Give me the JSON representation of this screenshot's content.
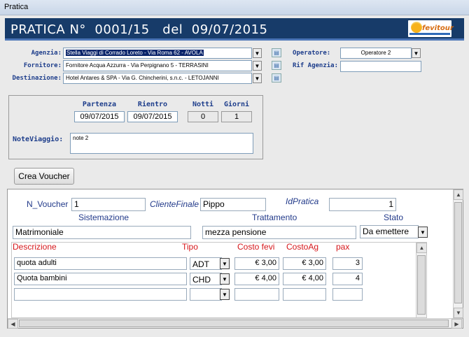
{
  "window": {
    "title": "Pratica"
  },
  "header": {
    "title": "PRATICA N°  0001/15   del  09/07/2015",
    "logo_text": "fevitour"
  },
  "top_fields": {
    "agenzia": {
      "label": "Agenzia:",
      "value": "Stella Viaggi di Corrado Loreto  -  Via Roma 62  -  AVOLA"
    },
    "fornitore": {
      "label": "Fornitore:",
      "value": "Fornitore Acqua Azzurra  -  Via Perpignano 5  -  TERRASINI"
    },
    "destinazione": {
      "label": "Destinazione:",
      "value": "Hotel Antares & SPA  -  Via G. Chincherini, s.n.c.  -  LETOJANNI"
    },
    "operatore": {
      "label": "Operatore:",
      "value": "Operatore 2"
    },
    "rif_agenzia": {
      "label": "Rif Agenzia:",
      "value": ""
    }
  },
  "travel": {
    "partenza_label": "Partenza",
    "partenza": "09/07/2015",
    "rientro_label": "Rientro",
    "rientro": "09/07/2015",
    "notti_label": "Notti",
    "notti": "0",
    "giorni_label": "Giorni",
    "giorni": "1",
    "note_label": "NoteViaggio:",
    "note": "note 2"
  },
  "crea_voucher_label": "Crea Voucher",
  "voucher": {
    "n_voucher_label": "N_Voucher",
    "n_voucher": "1",
    "cliente_label": "ClienteFinale",
    "cliente": "Pippo",
    "idpratica_label": "IdPratica",
    "idpratica": "1",
    "sistemazione_label": "Sistemazione",
    "sistemazione": "Matrimoniale",
    "trattamento_label": "Trattamento",
    "trattamento": "mezza pensione",
    "stato_label": "Stato",
    "stato": "Da emettere"
  },
  "details": {
    "columns": [
      "Descrizione",
      "Tipo",
      "Costo fevi",
      "CostoAg",
      "pax"
    ],
    "rows": [
      {
        "descrizione": "quota adulti",
        "tipo": "ADT",
        "costo_fevi": "€ 3,00",
        "costo_ag": "€ 3,00",
        "pax": "3"
      },
      {
        "descrizione": "Quota bambini",
        "tipo": "CHD",
        "costo_fevi": "€ 4,00",
        "costo_ag": "€ 4,00",
        "pax": "4"
      },
      {
        "descrizione": "",
        "tipo": "",
        "costo_fevi": "",
        "costo_ag": "",
        "pax": ""
      }
    ]
  },
  "colors": {
    "header_bg": "#173b69",
    "label_blue": "#1d3d8b",
    "column_red": "#d6171b"
  }
}
